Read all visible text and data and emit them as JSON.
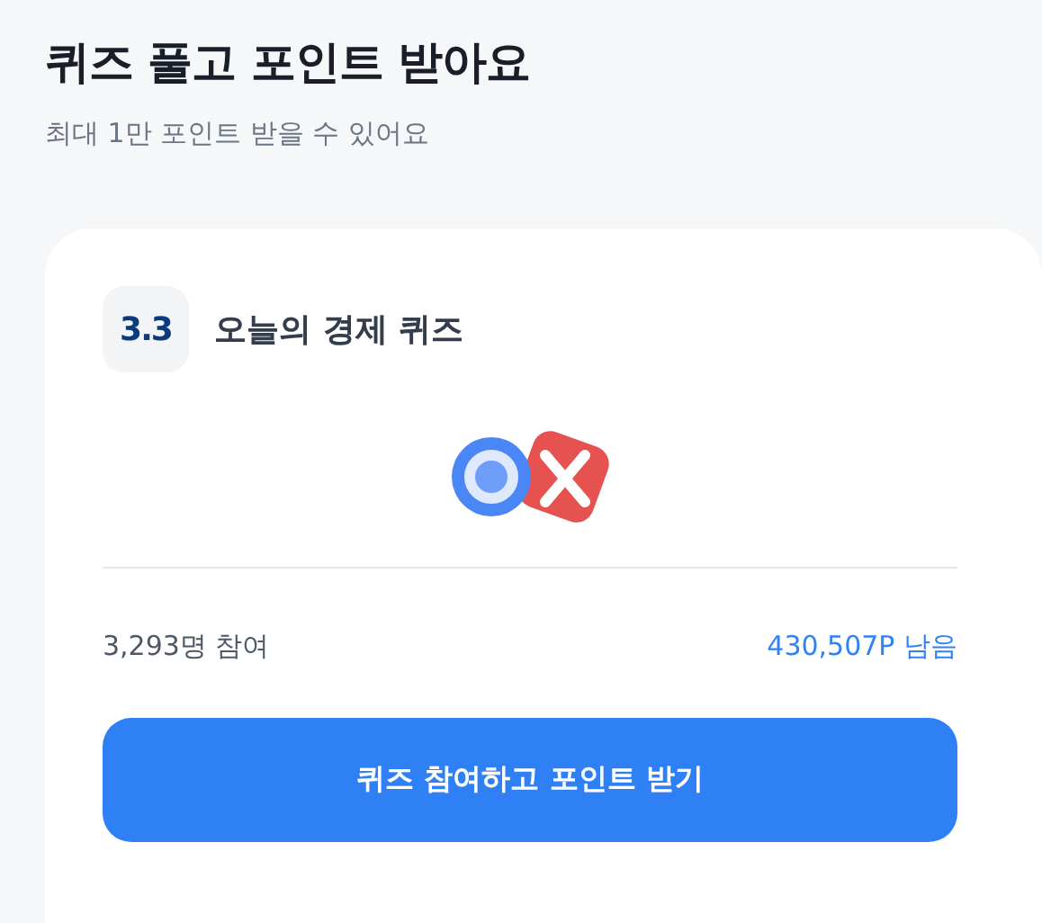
{
  "header": {
    "title": "퀴즈 풀고 포인트 받아요",
    "subtitle": "최대 1만 포인트 받을 수 있어요"
  },
  "card": {
    "logo": "3.3",
    "title": "오늘의 경제 퀴즈",
    "participants": "3,293명 참여",
    "remaining": "430,507P 남음",
    "button": "퀴즈 참여하고 포인트 받기"
  }
}
